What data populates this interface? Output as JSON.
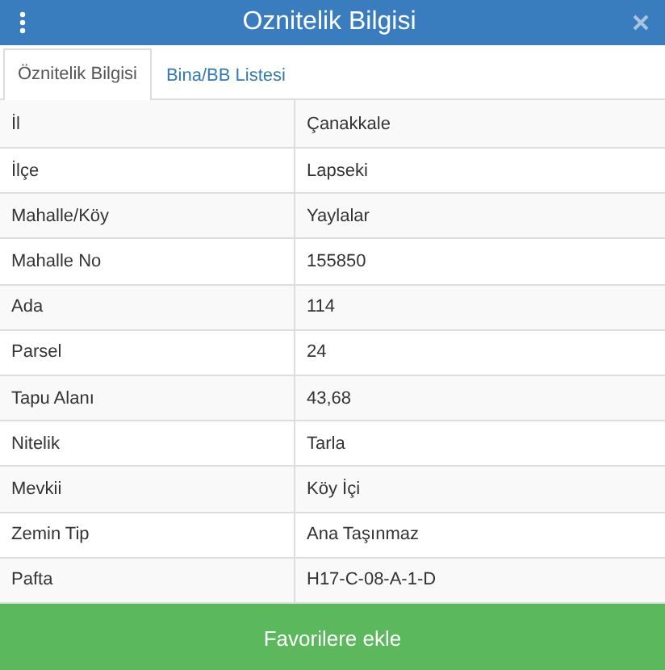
{
  "header": {
    "title": "Oznitelik Bilgisi"
  },
  "tabs": [
    {
      "label": "Öznitelik Bilgisi",
      "selected": true
    },
    {
      "label": "Bina/BB Listesi",
      "selected": false
    }
  ],
  "table": {
    "rows": [
      {
        "label": "İl",
        "value": "Çanakkale"
      },
      {
        "label": "İlçe",
        "value": "Lapseki"
      },
      {
        "label": "Mahalle/Köy",
        "value": "Yaylalar"
      },
      {
        "label": "Mahalle No",
        "value": "155850"
      },
      {
        "label": "Ada",
        "value": "114"
      },
      {
        "label": "Parsel",
        "value": "24"
      },
      {
        "label": "Tapu Alanı",
        "value": "43,68"
      },
      {
        "label": "Nitelik",
        "value": "Tarla"
      },
      {
        "label": "Mevkii",
        "value": "Köy İçi"
      },
      {
        "label": "Zemin Tip",
        "value": "Ana Taşınmaz"
      },
      {
        "label": "Pafta",
        "value": "H17-C-08-A-1-D"
      }
    ]
  },
  "action_button": {
    "label": "Favorilere ekle"
  }
}
